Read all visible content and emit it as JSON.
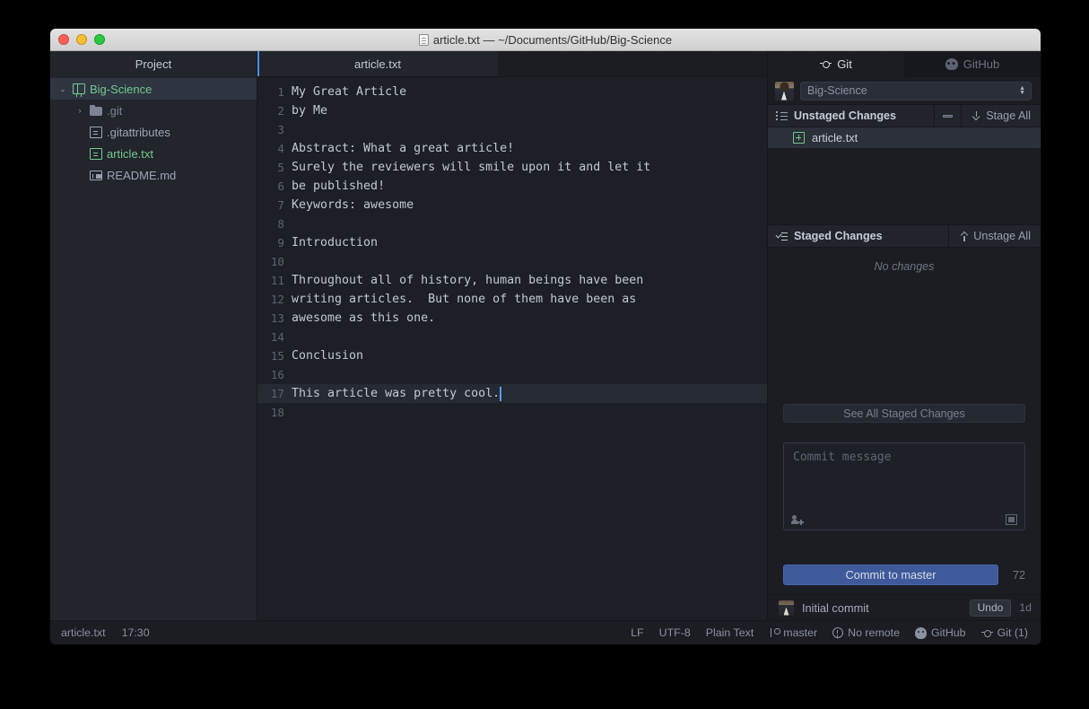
{
  "window": {
    "title": "article.txt — ~/Documents/GitHub/Big-Science",
    "title_icon": "document-icon"
  },
  "tree": {
    "header": "Project",
    "items": [
      {
        "label": "Big-Science",
        "icon": "repo-book-icon",
        "twisty": "⌄",
        "depth": 0,
        "selected": true,
        "color": "green"
      },
      {
        "label": ".git",
        "icon": "folder-icon",
        "twisty": "›",
        "depth": 1,
        "selected": false,
        "color": "dim"
      },
      {
        "label": ".gitattributes",
        "icon": "file-icon",
        "twisty": "",
        "depth": 1,
        "selected": false,
        "color": "normal"
      },
      {
        "label": "article.txt",
        "icon": "file-icon-green",
        "twisty": "",
        "depth": 1,
        "selected": false,
        "color": "green"
      },
      {
        "label": "README.md",
        "icon": "markdown-icon",
        "twisty": "",
        "depth": 1,
        "selected": false,
        "color": "normal"
      }
    ]
  },
  "editor": {
    "tab_label": "article.txt",
    "active_line": 17,
    "lines": [
      {
        "n": "1",
        "text": "My Great Article"
      },
      {
        "n": "2",
        "text": "by Me"
      },
      {
        "n": "3",
        "text": ""
      },
      {
        "n": "4",
        "text": "Abstract: What a great article!"
      },
      {
        "n": "5",
        "text": "Surely the reviewers will smile upon it and let it"
      },
      {
        "n": "6",
        "text": "be published!"
      },
      {
        "n": "7",
        "text": "Keywords: awesome"
      },
      {
        "n": "8",
        "text": ""
      },
      {
        "n": "9",
        "text": "Introduction"
      },
      {
        "n": "10",
        "text": ""
      },
      {
        "n": "11",
        "text": "Throughout all of history, human beings have been"
      },
      {
        "n": "12",
        "text": "writing articles.  But none of them have been as"
      },
      {
        "n": "13",
        "text": "awesome as this one."
      },
      {
        "n": "14",
        "text": ""
      },
      {
        "n": "15",
        "text": "Conclusion"
      },
      {
        "n": "16",
        "text": ""
      },
      {
        "n": "17",
        "text": "This article was pretty cool."
      },
      {
        "n": "18",
        "text": ""
      }
    ]
  },
  "git_panel": {
    "tabs": [
      {
        "label": "Git",
        "icon": "git-commit-icon",
        "active": true
      },
      {
        "label": "GitHub",
        "icon": "github-mark-icon",
        "active": false
      }
    ],
    "repo": {
      "selected": "Big-Science",
      "avatar": "user-avatar"
    },
    "unstaged": {
      "title": "Unstaged Changes",
      "icon": "list-unordered-icon",
      "collapse_label": "",
      "collapse_icon": "dash-icon",
      "action_label": "Stage All",
      "action_icon": "download-icon",
      "files": [
        {
          "name": "article.txt",
          "status": "added",
          "status_icon": "plus-box-icon"
        }
      ]
    },
    "staged": {
      "title": "Staged Changes",
      "icon": "checklist-icon",
      "action_label": "Unstage All",
      "action_icon": "upload-icon",
      "empty_text": "No changes",
      "see_all_label": "See All Staged Changes"
    },
    "commit": {
      "placeholder": "Commit message",
      "coauthor_icon": "add-coauthor-icon",
      "expand_icon": "expand-editor-icon",
      "button_label": "Commit to master",
      "char_count": "72"
    },
    "recent_commit": {
      "avatar": "author-avatar",
      "message": "Initial commit",
      "undo_label": "Undo",
      "time": "1d"
    }
  },
  "statusbar": {
    "left": [
      {
        "label": "article.txt",
        "icon": ""
      },
      {
        "label": "17:30",
        "icon": ""
      }
    ],
    "right": [
      {
        "label": "LF",
        "icon": ""
      },
      {
        "label": "UTF-8",
        "icon": ""
      },
      {
        "label": "Plain Text",
        "icon": ""
      },
      {
        "label": "master",
        "icon": "branch-icon"
      },
      {
        "label": "No remote",
        "icon": "warning-icon"
      },
      {
        "label": "GitHub",
        "icon": "github-mark-icon"
      },
      {
        "label": "Git (1)",
        "icon": "git-commit-icon"
      }
    ]
  },
  "colors": {
    "accent_blue": "#4d8ef7",
    "commit_button": "#3e5a9b",
    "green": "#73c990",
    "panel_bg": "#1b1d23",
    "editor_bg": "#1d1f26"
  }
}
